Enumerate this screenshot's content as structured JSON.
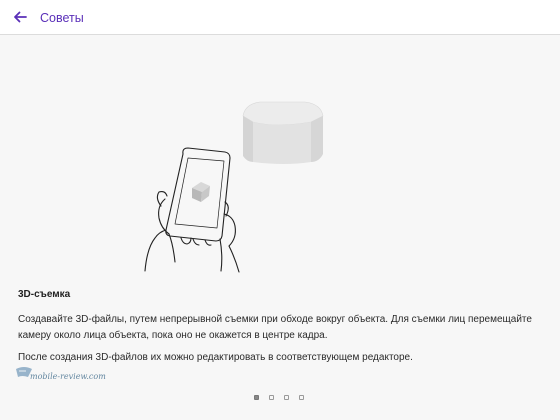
{
  "app_bar": {
    "title": "Советы",
    "back_icon": "arrow-left-icon",
    "accent_color": "#5a2fb8"
  },
  "tip": {
    "illustration": "hand-holding-tablet-with-cube-icon",
    "title": "3D-съемка",
    "paragraph_1": "Создавайте 3D-файлы, путем непрерывной съемки при обходе вокруг объекта. Для съемки лиц перемещайте камеру около лица объекта, пока оно не окажется в центре кадра.",
    "paragraph_2": "После создания 3D-файлов их можно редактировать в соответствующем редакторе."
  },
  "watermark": {
    "text": "mobile-review.com"
  },
  "pager": {
    "total_pages": 4,
    "current_page": 1
  }
}
